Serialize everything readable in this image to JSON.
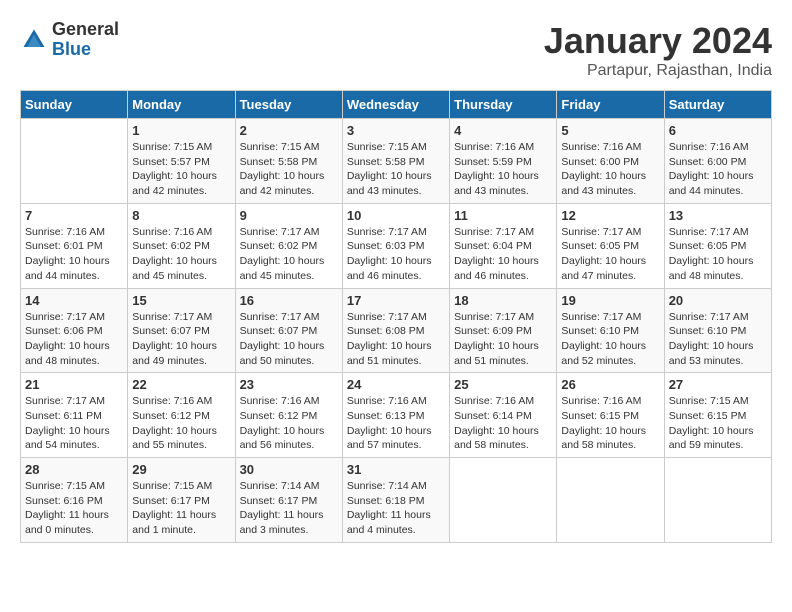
{
  "logo": {
    "general": "General",
    "blue": "Blue"
  },
  "title": "January 2024",
  "location": "Partapur, Rajasthan, India",
  "headers": [
    "Sunday",
    "Monday",
    "Tuesday",
    "Wednesday",
    "Thursday",
    "Friday",
    "Saturday"
  ],
  "weeks": [
    [
      {
        "day": "",
        "info": ""
      },
      {
        "day": "1",
        "info": "Sunrise: 7:15 AM\nSunset: 5:57 PM\nDaylight: 10 hours\nand 42 minutes."
      },
      {
        "day": "2",
        "info": "Sunrise: 7:15 AM\nSunset: 5:58 PM\nDaylight: 10 hours\nand 42 minutes."
      },
      {
        "day": "3",
        "info": "Sunrise: 7:15 AM\nSunset: 5:58 PM\nDaylight: 10 hours\nand 43 minutes."
      },
      {
        "day": "4",
        "info": "Sunrise: 7:16 AM\nSunset: 5:59 PM\nDaylight: 10 hours\nand 43 minutes."
      },
      {
        "day": "5",
        "info": "Sunrise: 7:16 AM\nSunset: 6:00 PM\nDaylight: 10 hours\nand 43 minutes."
      },
      {
        "day": "6",
        "info": "Sunrise: 7:16 AM\nSunset: 6:00 PM\nDaylight: 10 hours\nand 44 minutes."
      }
    ],
    [
      {
        "day": "7",
        "info": "Sunrise: 7:16 AM\nSunset: 6:01 PM\nDaylight: 10 hours\nand 44 minutes."
      },
      {
        "day": "8",
        "info": "Sunrise: 7:16 AM\nSunset: 6:02 PM\nDaylight: 10 hours\nand 45 minutes."
      },
      {
        "day": "9",
        "info": "Sunrise: 7:17 AM\nSunset: 6:02 PM\nDaylight: 10 hours\nand 45 minutes."
      },
      {
        "day": "10",
        "info": "Sunrise: 7:17 AM\nSunset: 6:03 PM\nDaylight: 10 hours\nand 46 minutes."
      },
      {
        "day": "11",
        "info": "Sunrise: 7:17 AM\nSunset: 6:04 PM\nDaylight: 10 hours\nand 46 minutes."
      },
      {
        "day": "12",
        "info": "Sunrise: 7:17 AM\nSunset: 6:05 PM\nDaylight: 10 hours\nand 47 minutes."
      },
      {
        "day": "13",
        "info": "Sunrise: 7:17 AM\nSunset: 6:05 PM\nDaylight: 10 hours\nand 48 minutes."
      }
    ],
    [
      {
        "day": "14",
        "info": "Sunrise: 7:17 AM\nSunset: 6:06 PM\nDaylight: 10 hours\nand 48 minutes."
      },
      {
        "day": "15",
        "info": "Sunrise: 7:17 AM\nSunset: 6:07 PM\nDaylight: 10 hours\nand 49 minutes."
      },
      {
        "day": "16",
        "info": "Sunrise: 7:17 AM\nSunset: 6:07 PM\nDaylight: 10 hours\nand 50 minutes."
      },
      {
        "day": "17",
        "info": "Sunrise: 7:17 AM\nSunset: 6:08 PM\nDaylight: 10 hours\nand 51 minutes."
      },
      {
        "day": "18",
        "info": "Sunrise: 7:17 AM\nSunset: 6:09 PM\nDaylight: 10 hours\nand 51 minutes."
      },
      {
        "day": "19",
        "info": "Sunrise: 7:17 AM\nSunset: 6:10 PM\nDaylight: 10 hours\nand 52 minutes."
      },
      {
        "day": "20",
        "info": "Sunrise: 7:17 AM\nSunset: 6:10 PM\nDaylight: 10 hours\nand 53 minutes."
      }
    ],
    [
      {
        "day": "21",
        "info": "Sunrise: 7:17 AM\nSunset: 6:11 PM\nDaylight: 10 hours\nand 54 minutes."
      },
      {
        "day": "22",
        "info": "Sunrise: 7:16 AM\nSunset: 6:12 PM\nDaylight: 10 hours\nand 55 minutes."
      },
      {
        "day": "23",
        "info": "Sunrise: 7:16 AM\nSunset: 6:12 PM\nDaylight: 10 hours\nand 56 minutes."
      },
      {
        "day": "24",
        "info": "Sunrise: 7:16 AM\nSunset: 6:13 PM\nDaylight: 10 hours\nand 57 minutes."
      },
      {
        "day": "25",
        "info": "Sunrise: 7:16 AM\nSunset: 6:14 PM\nDaylight: 10 hours\nand 58 minutes."
      },
      {
        "day": "26",
        "info": "Sunrise: 7:16 AM\nSunset: 6:15 PM\nDaylight: 10 hours\nand 58 minutes."
      },
      {
        "day": "27",
        "info": "Sunrise: 7:15 AM\nSunset: 6:15 PM\nDaylight: 10 hours\nand 59 minutes."
      }
    ],
    [
      {
        "day": "28",
        "info": "Sunrise: 7:15 AM\nSunset: 6:16 PM\nDaylight: 11 hours\nand 0 minutes."
      },
      {
        "day": "29",
        "info": "Sunrise: 7:15 AM\nSunset: 6:17 PM\nDaylight: 11 hours\nand 1 minute."
      },
      {
        "day": "30",
        "info": "Sunrise: 7:14 AM\nSunset: 6:17 PM\nDaylight: 11 hours\nand 3 minutes."
      },
      {
        "day": "31",
        "info": "Sunrise: 7:14 AM\nSunset: 6:18 PM\nDaylight: 11 hours\nand 4 minutes."
      },
      {
        "day": "",
        "info": ""
      },
      {
        "day": "",
        "info": ""
      },
      {
        "day": "",
        "info": ""
      }
    ]
  ]
}
